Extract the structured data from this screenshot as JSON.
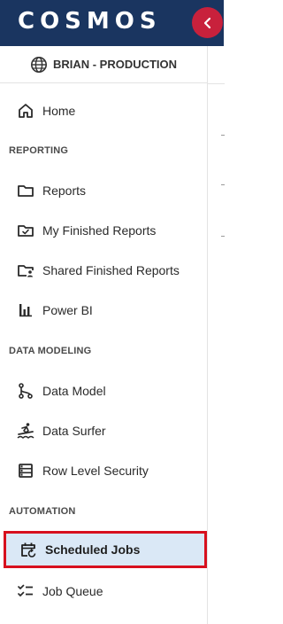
{
  "header": {
    "logo_text": "COSMOS",
    "collapse_icon": "chevron-left-icon",
    "accent": "#c8213c",
    "bar_color": "#1a3560"
  },
  "tenant": {
    "icon": "globe-icon",
    "label": "BRIAN - PRODUCTION"
  },
  "nav": {
    "home": {
      "label": "Home",
      "icon": "home-icon"
    },
    "sections": {
      "reporting": "REPORTING",
      "data_modeling": "DATA MODELING",
      "automation": "AUTOMATION"
    },
    "items": {
      "reports": {
        "label": "Reports",
        "icon": "folder-icon"
      },
      "my_finished_reports": {
        "label": "My Finished Reports",
        "icon": "folder-check-icon"
      },
      "shared_finished_reports": {
        "label": "Shared Finished Reports",
        "icon": "folder-shared-icon"
      },
      "power_bi": {
        "label": "Power BI",
        "icon": "bar-chart-icon"
      },
      "data_model": {
        "label": "Data Model",
        "icon": "branch-icon"
      },
      "data_surfer": {
        "label": "Data Surfer",
        "icon": "surfer-icon"
      },
      "row_level_security": {
        "label": "Row Level Security",
        "icon": "table-rows-icon"
      },
      "scheduled_jobs": {
        "label": "Scheduled Jobs",
        "icon": "calendar-refresh-icon",
        "selected": true
      },
      "job_queue": {
        "label": "Job Queue",
        "icon": "checklist-icon"
      }
    }
  },
  "highlight_color": "#d7101e",
  "selected_bg": "#dae8f6"
}
